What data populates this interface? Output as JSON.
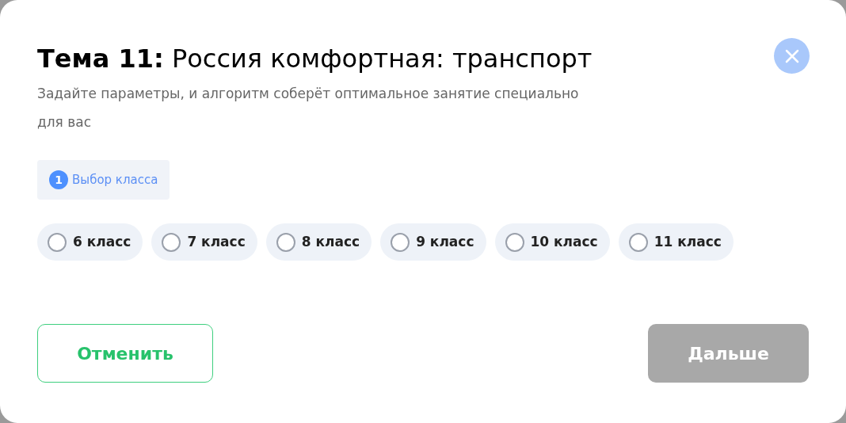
{
  "dialog": {
    "title": "**Тема 11:** Россия комфортная: транспорт",
    "subtitle": "Задайте параметры, и алгоритм соберёт оптимальное занятие специально для вас"
  },
  "step": {
    "number": "1",
    "label": "Выбор класса"
  },
  "options": [
    {
      "label": "6 класс",
      "selected": false
    },
    {
      "label": "7 класс",
      "selected": false
    },
    {
      "label": "8 класс",
      "selected": false
    },
    {
      "label": "9 класс",
      "selected": false
    },
    {
      "label": "10 класс",
      "selected": false
    },
    {
      "label": "11 класс",
      "selected": false
    }
  ],
  "buttons": {
    "cancel": {
      "label": "Отменить"
    },
    "next": {
      "label": "Дальше",
      "disabled": true
    }
  }
}
